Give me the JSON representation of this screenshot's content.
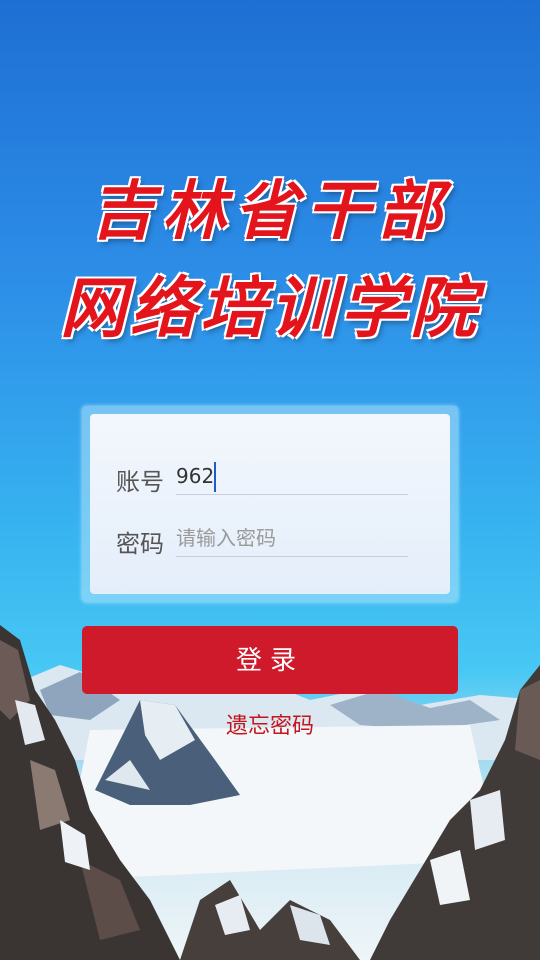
{
  "header": {
    "title_line1": "吉林省干部",
    "title_line2": "网络培训学院"
  },
  "form": {
    "account_label": "账号",
    "account_value": "962",
    "password_label": "密码",
    "password_placeholder": "请输入密码"
  },
  "actions": {
    "login_label": "登录",
    "forgot_label": "遗忘密码"
  },
  "colors": {
    "title_red": "#e3141c",
    "button_red": "#cf1a2b",
    "link_red": "#c2161f"
  }
}
